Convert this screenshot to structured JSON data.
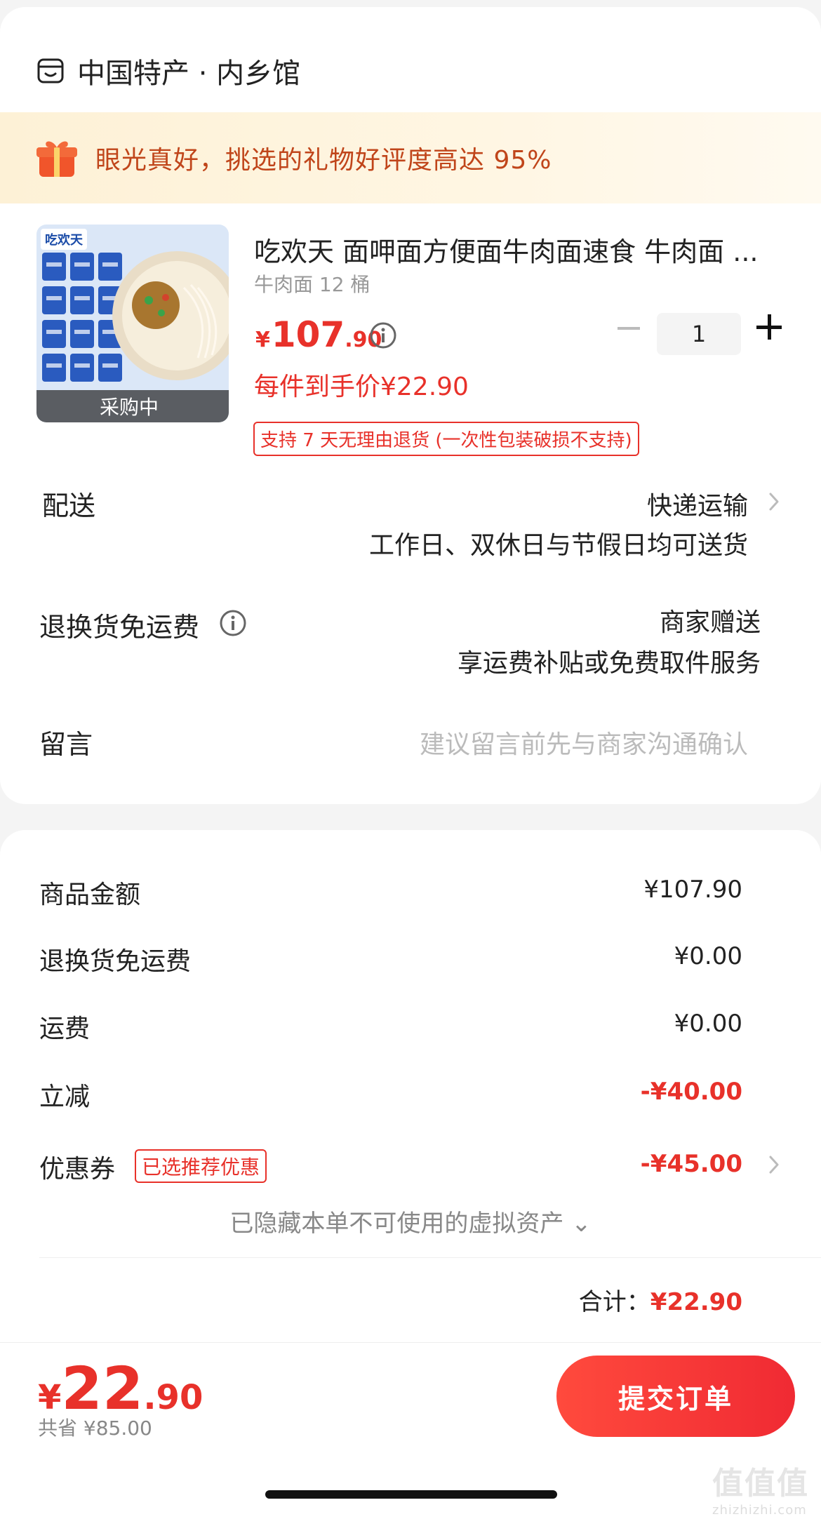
{
  "shop": {
    "name": "中国特产 · 内乡馆",
    "icon": "shop-icon"
  },
  "banner": {
    "text": "眼光真好，挑选的礼物好评度高达 95%",
    "icon": "gift-icon",
    "text_color": "#c0451a"
  },
  "product": {
    "title": "吃欢天 面呷面方便面牛肉面速食 牛肉面 ...",
    "spec": "牛肉面 12 桶",
    "price_currency": "¥",
    "price_int": "107",
    "price_dec": ".90",
    "each_price": "每件到手价¥22.90",
    "return_policy": "支持 7 天无理由退货 (一次性包装破损不支持)",
    "image_brand": "吃欢天",
    "buying_label": "采购中",
    "quantity": "1"
  },
  "delivery": {
    "label": "配送",
    "method": "快递运输",
    "note": "工作日、双休日与节假日均可送货"
  },
  "return_shipping": {
    "label": "退换货免运费",
    "value": "商家赠送",
    "note": "享运费补贴或免费取件服务"
  },
  "message": {
    "label": "留言",
    "placeholder": "建议留言前先与商家沟通确认"
  },
  "summary": {
    "rows": [
      {
        "label": "商品金额",
        "value": "¥107.90"
      },
      {
        "label": "退换货免运费",
        "value": "¥0.00"
      },
      {
        "label": "运费",
        "value": "¥0.00"
      },
      {
        "label": "立减",
        "value": "-¥40.00"
      },
      {
        "label": "优惠券",
        "value": "-¥45.00"
      }
    ],
    "coupon_tag": "已选推荐优惠",
    "hidden_assets": "已隐藏本单不可使用的虚拟资产 ⌄",
    "total_label": "合计：",
    "total_value": "¥22.90"
  },
  "bottom": {
    "currency": "¥",
    "price_int": "22",
    "price_dec": ".90",
    "saved": "共省 ¥85.00",
    "submit_label": "提交订单"
  },
  "watermark": {
    "mark": "值值值",
    "url": "zhizhizhi.com"
  },
  "colors": {
    "accent": "#e8312a",
    "banner_bg": "#fdf1d6"
  }
}
